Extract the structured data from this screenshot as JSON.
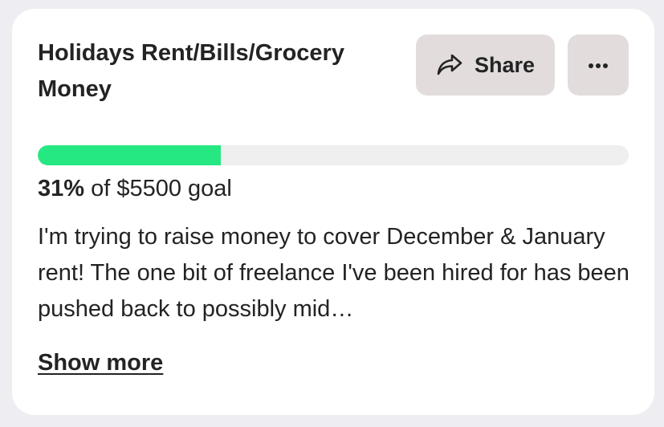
{
  "fundraiser": {
    "title": "Holidays Rent/Bills/Grocery Money",
    "share_label": "Share",
    "share_icon": "share-arrow-icon",
    "more_icon": "ellipsis-icon",
    "progress": {
      "percent": 31,
      "percent_text": "31%",
      "goal_text": " of $5500 goal",
      "fill_color": "#26e882",
      "track_color": "#efefef"
    },
    "description": "I'm trying to raise money to cover December & January rent! The one bit of freelance I've been hired for has been pushed back to possibly mid…",
    "show_more_label": "Show more"
  }
}
